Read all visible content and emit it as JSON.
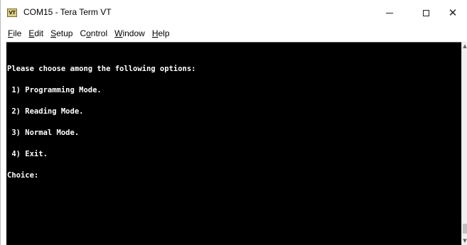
{
  "window": {
    "title": "COM15 - Tera Term VT",
    "app_icon_text": "VT"
  },
  "menu": [
    {
      "accel": "F",
      "rest": "ile"
    },
    {
      "accel": "E",
      "rest": "dit"
    },
    {
      "accel": "S",
      "rest": "etup"
    },
    {
      "prefix": "C",
      "accel": "o",
      "rest": "ntrol"
    },
    {
      "accel": "W",
      "rest": "indow"
    },
    {
      "accel": "H",
      "rest": "elp"
    }
  ],
  "terminal": {
    "lines": [
      "Please choose among the following options:",
      " 1) Programming Mode.",
      " 2) Reading Mode.",
      " 3) Normal Mode.",
      " 4) Exit.",
      "Choice:"
    ]
  },
  "colors": {
    "terminal_bg": "#000000",
    "terminal_fg": "#ffffff"
  },
  "icons": {
    "minimize": "minimize-icon",
    "maximize": "maximize-icon",
    "close": "close-icon"
  }
}
